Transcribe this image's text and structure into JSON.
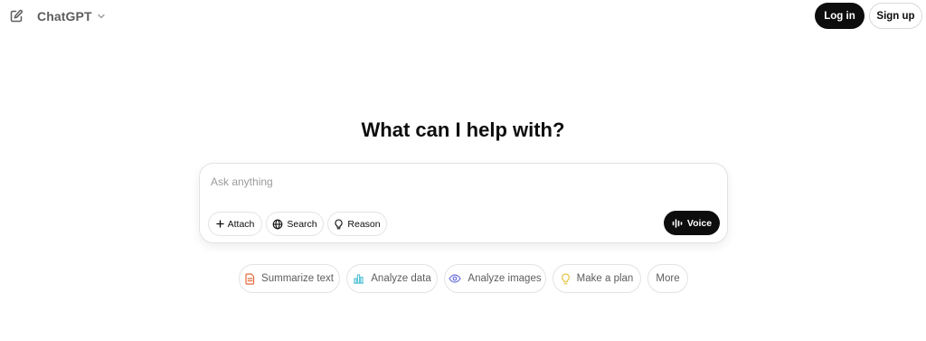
{
  "header": {
    "new_chat_icon": "edit-icon",
    "model_name": "ChatGPT",
    "model_chevron_icon": "chevron-down-icon",
    "login_label": "Log in",
    "signup_label": "Sign up"
  },
  "main": {
    "headline": "What can I help with?",
    "composer": {
      "placeholder": "Ask anything",
      "value": "",
      "tools": [
        {
          "label": "Attach",
          "icon": "plus-icon"
        },
        {
          "label": "Search",
          "icon": "globe-icon"
        },
        {
          "label": "Reason",
          "icon": "lightbulb-icon"
        }
      ],
      "voice_label": "Voice",
      "voice_icon": "voice-wave-icon"
    },
    "suggestions": [
      {
        "label": "Summarize text",
        "icon": "document-icon",
        "color": "#e2693c"
      },
      {
        "label": "Analyze data",
        "icon": "bar-chart-icon",
        "color": "#5bc4d8"
      },
      {
        "label": "Analyze images",
        "icon": "eye-icon",
        "color": "#6c71d9"
      },
      {
        "label": "Make a plan",
        "icon": "lightbulb-icon",
        "color": "#e2c541"
      },
      {
        "label": "More"
      }
    ]
  },
  "colors": {
    "primary_button": "#0d0d0d",
    "border": "#e3e3e3",
    "muted_text": "#5d5d5d",
    "placeholder": "#9b9b9b"
  }
}
